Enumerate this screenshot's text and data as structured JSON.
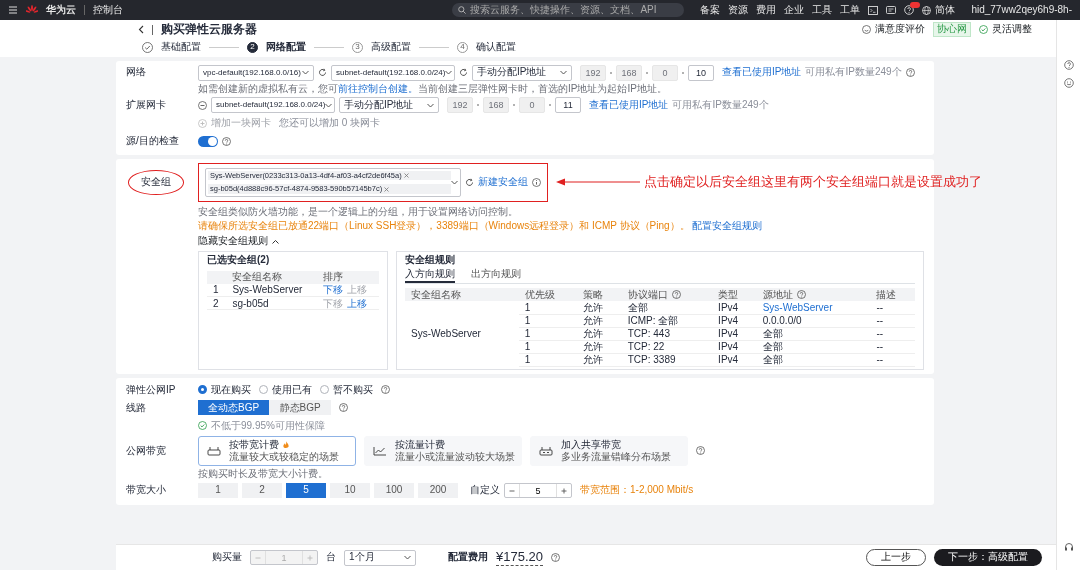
{
  "topbar": {
    "brand": "华为云",
    "section": "控制台",
    "search": {
      "placeholder": "搜索云服务、快捷操作、资源、文档、API"
    },
    "links": [
      "备案",
      "资源",
      "费用",
      "企业",
      "工具",
      "工单"
    ],
    "language": "简体",
    "user": "hid_77ww2qey6h9-8h-"
  },
  "header": {
    "title": "购买弹性云服务器",
    "feedback": "满意度评价",
    "tag": "协心网",
    "adjust": "灵活调整"
  },
  "steps": [
    {
      "label": "基础配置",
      "done": true,
      "selected": false
    },
    {
      "number": "2",
      "label": "网络配置",
      "done": false,
      "selected": true
    },
    {
      "number": "3",
      "label": "高级配置",
      "done": false,
      "selected": false
    },
    {
      "number": "4",
      "label": "确认配置",
      "done": false,
      "selected": false
    }
  ],
  "network": {
    "label": "网络",
    "vpc": "vpc-default(192.168.0.0/16)",
    "subnet": "subnet-default(192.168.0.0/24)",
    "ip_mode": "手动分配IP地址",
    "ip": [
      {
        "value": "192",
        "disabled": true
      },
      {
        "value": "168",
        "disabled": true
      },
      {
        "value": "0",
        "disabled": true
      },
      {
        "value": "10",
        "disabled": false
      }
    ],
    "ip_link": "查看已使用IP地址",
    "available": "可用私有IP数量249个",
    "hint": "如需创建新的虚拟私有云，您可",
    "hint_link": "前往控制台创建。",
    "hint_rest": "当前创建三层弹性网卡时，首选的IP地址为起始IP地址。"
  },
  "extension_nic": {
    "label": "扩展网卡",
    "subnet": "subnet-default(192.168.0.0/24)",
    "ip_mode": "手动分配IP地址",
    "ip": [
      {
        "value": "192",
        "disabled": true
      },
      {
        "value": "168",
        "disabled": true
      },
      {
        "value": "0",
        "disabled": true
      },
      {
        "value": "11",
        "disabled": false
      }
    ],
    "ip_link": "查看已使用IP地址",
    "available": "可用私有IP数量249个",
    "add": "增加一块网卡",
    "add_disabled": true,
    "remaining": "您还可以增加 0 块网卡"
  },
  "source_check": {
    "label": "源/目的检查",
    "on": true
  },
  "security_group": {
    "label": "安全组",
    "tags": [
      "Sys-WebServer(0233c313-0a13-4df4-af03-a4cf2de6f45a)",
      "sg-b05d(4d888c96-57cf-4874-9583-590b57145b7c)"
    ],
    "create_link": "新建安全组",
    "hint": "安全组类似防火墙功能，是一个逻辑上的分组，用于设置网络访问控制。",
    "warning": "请确保所选安全组已放通22端口（Linux SSH登录），3389端口（Windows远程登录）和 ICMP 协议（Ping）。",
    "warning_link": "配置安全组规则",
    "toggle": "隐藏安全组规则",
    "expanded": true,
    "selected_panel": {
      "title": "已选安全组(2)",
      "columns": [
        "安全组名称",
        "排序"
      ],
      "rows": [
        {
          "index": "1",
          "name": "Sys-WebServer",
          "down": "下移",
          "down_enabled": true,
          "up": "上移",
          "up_enabled": false
        },
        {
          "index": "2",
          "name": "sg-b05d",
          "down": "下移",
          "down_enabled": false,
          "up": "上移",
          "up_enabled": true
        }
      ]
    },
    "rules_panel": {
      "title": "安全组规则",
      "tabs": [
        {
          "label": "入方向规则",
          "selected": true
        },
        {
          "label": "出方向规则",
          "selected": false
        }
      ],
      "columns": [
        {
          "label": "安全组名称",
          "help": false
        },
        {
          "label": "优先级",
          "help": false
        },
        {
          "label": "策略",
          "help": false
        },
        {
          "label": "协议端口",
          "help": true
        },
        {
          "label": "类型",
          "help": false
        },
        {
          "label": "源地址",
          "help": true
        },
        {
          "label": "描述",
          "help": false
        }
      ],
      "group": "Sys-WebServer",
      "rows": [
        {
          "priority": "1",
          "action": "允许",
          "port": "全部",
          "type": "IPv4",
          "source": "Sys-WebServer",
          "source_linked": true,
          "description": "--"
        },
        {
          "priority": "1",
          "action": "允许",
          "port": "ICMP: 全部",
          "type": "IPv4",
          "source": "0.0.0.0/0",
          "source_linked": false,
          "description": "--"
        },
        {
          "priority": "1",
          "action": "允许",
          "port": "TCP: 443",
          "type": "IPv4",
          "source": "全部",
          "source_linked": false,
          "description": "--"
        },
        {
          "priority": "1",
          "action": "允许",
          "port": "TCP: 22",
          "type": "IPv4",
          "source": "全部",
          "source_linked": false,
          "description": "--"
        },
        {
          "priority": "1",
          "action": "允许",
          "port": "TCP: 3389",
          "type": "IPv4",
          "source": "全部",
          "source_linked": false,
          "description": "--"
        }
      ]
    }
  },
  "annotation": {
    "text": "点击确定以后安全组这里有两个安全组端口就是设置成功了"
  },
  "eip": {
    "label": "弹性公网IP",
    "options": [
      {
        "label": "现在购买",
        "selected": true
      },
      {
        "label": "使用已有",
        "selected": false
      },
      {
        "label": "暂不购买",
        "selected": false
      }
    ],
    "line_label": "线路",
    "lines": [
      {
        "label": "全动态BGP",
        "selected": true
      },
      {
        "label": "静态BGP",
        "selected": false
      }
    ],
    "sla": "不低于99.95%可用性保障",
    "billing_label": "公网带宽",
    "billing": [
      {
        "kind": "router",
        "title": "按带宽计费",
        "subtitle": "流量较大或较稳定的场景",
        "hot": true,
        "selected": true
      },
      {
        "kind": "chart",
        "title": "按流量计费",
        "subtitle": "流量小或流量波动较大场景",
        "hot": false,
        "selected": false
      },
      {
        "kind": "shared",
        "title": "加入共享带宽",
        "subtitle": "多业务流量错峰分布场景",
        "hot": false,
        "selected": false
      }
    ],
    "billing_hint": "按购买时长及带宽大小计费。",
    "size_label": "带宽大小",
    "sizes": [
      {
        "label": "1",
        "selected": false
      },
      {
        "label": "2",
        "selected": false
      },
      {
        "label": "5",
        "selected": true
      },
      {
        "label": "10",
        "selected": false
      },
      {
        "label": "100",
        "selected": false
      },
      {
        "label": "200",
        "selected": false
      }
    ],
    "custom_label": "自定义",
    "custom_value": "5",
    "range": "带宽范围：1-2,000 Mbit/s"
  },
  "footer": {
    "quantity_label": "购买量",
    "quantity": "1",
    "unit": "台",
    "duration": "1个月",
    "price_label": "配置费用",
    "price": "¥175.20",
    "prev": "上一步",
    "next": "下一步：高级配置"
  }
}
